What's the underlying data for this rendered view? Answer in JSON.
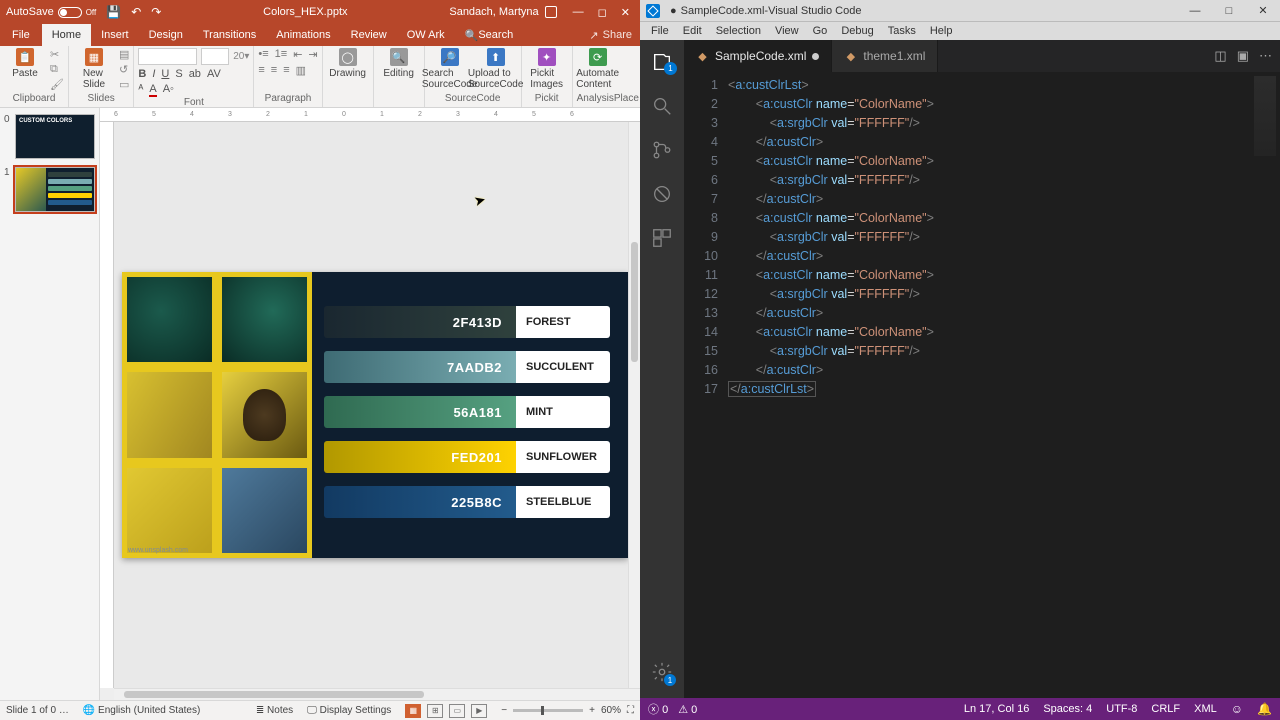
{
  "powerpoint": {
    "title_autosave": "AutoSave",
    "title_autosave_state": "Off",
    "title_doc": "Colors_HEX.pptx",
    "title_user": "Sandach, Martyna",
    "ribbon_tabs": [
      "File",
      "Home",
      "Insert",
      "Design",
      "Transitions",
      "Animations",
      "Review",
      "OW Ark",
      "Search"
    ],
    "ribbon_share": "Share",
    "groups": {
      "clipboard": {
        "paste": "Paste",
        "label": "Clipboard"
      },
      "slides": {
        "new": "New\nSlide",
        "label": "Slides"
      },
      "font": {
        "label": "Font"
      },
      "paragraph": {
        "label": "Paragraph"
      },
      "drawing": {
        "label": "Drawing",
        "btn": "Drawing"
      },
      "editing": {
        "label": "Editing",
        "btn": "Editing"
      },
      "sourcecode": {
        "label": "SourceCode",
        "search": "Search\nSourceCode",
        "upload": "Upload to\nSourceCode"
      },
      "pickit": {
        "label": "Pickit",
        "btn": "Pickit\nImages"
      },
      "analysis": {
        "label": "AnalysisPlace",
        "btn": "Automate\nContent"
      }
    },
    "thumbnails": {
      "t0": "CUSTOM COLORS"
    },
    "colors": [
      {
        "hex": "2F413D",
        "name": "FOREST"
      },
      {
        "hex": "7AADB2",
        "name": "SUCCULENT"
      },
      {
        "hex": "56A181",
        "name": "MINT"
      },
      {
        "hex": "FED201",
        "name": "SUNFLOWER"
      },
      {
        "hex": "225B8C",
        "name": "STEELBLUE"
      }
    ],
    "slide_src": "www.unsplash.com",
    "status": {
      "slide": "Slide 1 of 0 …",
      "lang": "English (United States)",
      "notes": "Notes",
      "display": "Display Settings",
      "zoom": "60%"
    },
    "ruler": [
      "6",
      "5",
      "4",
      "3",
      "2",
      "1",
      "0",
      "1",
      "2",
      "3",
      "4",
      "5",
      "6"
    ]
  },
  "vscode": {
    "title_file": "SampleCode.xml",
    "title_app": "Visual Studio Code",
    "menu": [
      "File",
      "Edit",
      "Selection",
      "View",
      "Go",
      "Debug",
      "Tasks",
      "Help"
    ],
    "activity_badge": "1",
    "tabs": [
      {
        "name": "SampleCode.xml",
        "modified": true
      },
      {
        "name": "theme1.xml",
        "modified": false
      }
    ],
    "gear_badge": "1",
    "code": {
      "open_list": "<a:custClrLst>",
      "open_clr": "<a:custClr ",
      "name_attr": "name=",
      "name_val": "\"ColorName\"",
      "close_tag": ">",
      "srgb_open": "<a:srgbClr ",
      "val_attr": "val=",
      "val_val": "\"FFFFFF\"",
      "self_close": "/>",
      "close_clr": "</a:custClr>",
      "close_list": "</a:custClrLst>"
    },
    "line_count": 17,
    "status": {
      "errors": "0",
      "warnings": "0",
      "cursor": "Ln 17, Col 16",
      "spaces": "Spaces: 4",
      "encoding": "UTF-8",
      "eol": "CRLF",
      "lang": "XML",
      "feedback": "☺",
      "bell": "🔔"
    }
  }
}
